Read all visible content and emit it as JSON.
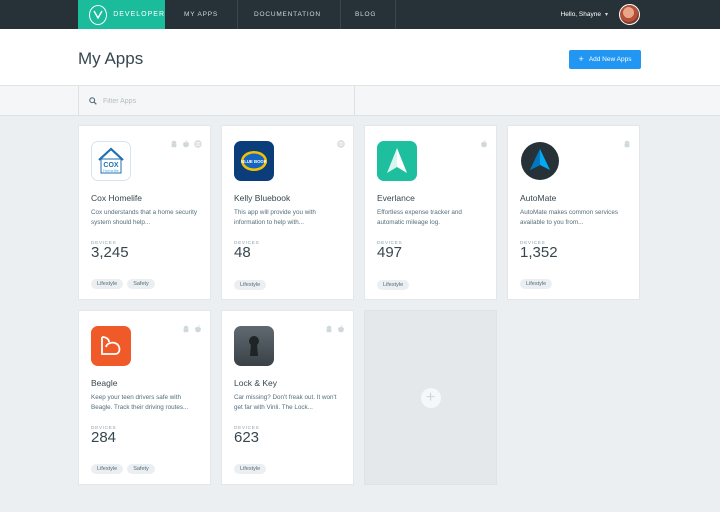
{
  "nav": {
    "brand": "DEVELOPER",
    "links": [
      "MY APPS",
      "DOCUMENTATION",
      "BLOG"
    ],
    "user": "Hello, Shayne"
  },
  "header": {
    "title": "My Apps",
    "add_button": "Add New Apps"
  },
  "filter": {
    "placeholder": "Filter Apps"
  },
  "colors": {
    "brand": "#1abc9c",
    "nav_bg": "#263238",
    "accent": "#2196f3"
  },
  "apps": [
    {
      "name": "Cox Homelife",
      "desc": "Cox understands that a home security system should help...",
      "devices_label": "DEVICES",
      "devices": "3,245",
      "tags": [
        "Lifestyle",
        "Safety"
      ],
      "icon": "cox-homelife-icon",
      "icon_text": "COX",
      "icon_sub": "Homelife",
      "platforms": [
        "android-icon",
        "apple-icon",
        "web-icon"
      ]
    },
    {
      "name": "Kelly Bluebook",
      "desc": "This app will provide you with information to help with...",
      "devices_label": "DEVICES",
      "devices": "48",
      "tags": [
        "Lifestyle"
      ],
      "icon": "kelly-bluebook-icon",
      "icon_text": "BLUE BOOK",
      "platforms": [
        "web-icon"
      ]
    },
    {
      "name": "Everlance",
      "desc": "Effortless expense tracker and automatic mileage log.",
      "devices_label": "DEVICES",
      "devices": "497",
      "tags": [
        "Lifestyle"
      ],
      "icon": "everlance-icon",
      "platforms": [
        "apple-icon"
      ]
    },
    {
      "name": "AutoMate",
      "desc": "AutoMate makes common services available to you from...",
      "devices_label": "DEVICES",
      "devices": "1,352",
      "tags": [
        "Lifestyle"
      ],
      "icon": "automate-icon",
      "platforms": [
        "android-icon"
      ]
    },
    {
      "name": "Beagle",
      "desc": "Keep your teen drivers safe with Beagle. Track their driving routes...",
      "devices_label": "DEVICES",
      "devices": "284",
      "tags": [
        "Lifestyle",
        "Safety"
      ],
      "icon": "beagle-icon",
      "platforms": [
        "android-icon",
        "apple-icon"
      ]
    },
    {
      "name": "Lock & Key",
      "desc": "Car missing? Don't freak out. It won't get far with Vinli. The Lock...",
      "devices_label": "DEVICES",
      "devices": "623",
      "tags": [
        "Lifestyle"
      ],
      "icon": "lock-and-key-icon",
      "platforms": [
        "android-icon",
        "apple-icon"
      ]
    }
  ]
}
